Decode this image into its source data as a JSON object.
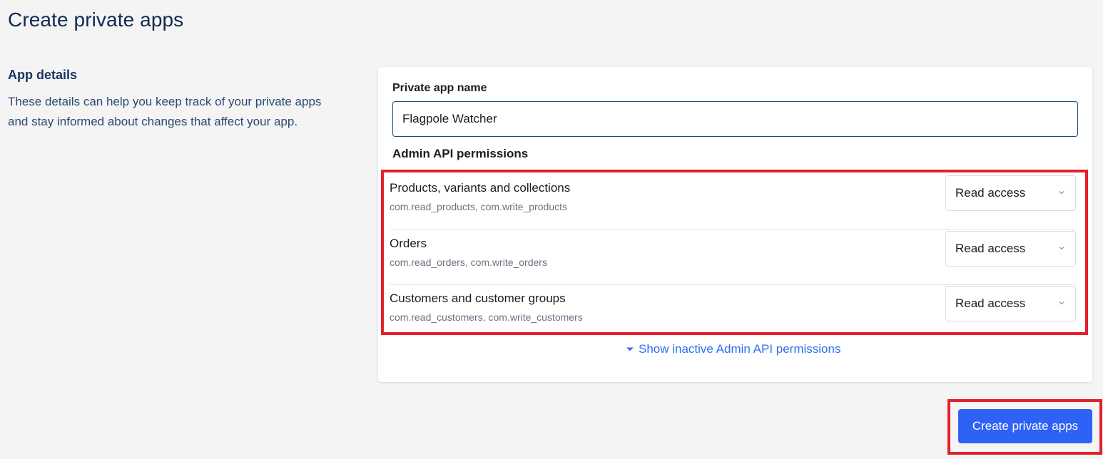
{
  "page": {
    "title": "Create private apps"
  },
  "app_details": {
    "heading": "App details",
    "description": "These details can help you keep track of your private apps and stay informed about changes that affect your app."
  },
  "form": {
    "name_label": "Private app name",
    "name_value": "Flagpole Watcher",
    "permissions_heading": "Admin API permissions",
    "permissions": [
      {
        "name": "Products, variants and collections",
        "scopes": "com.read_products, com.write_products",
        "access": "Read access"
      },
      {
        "name": "Orders",
        "scopes": "com.read_orders, com.write_orders",
        "access": "Read access"
      },
      {
        "name": "Customers and customer groups",
        "scopes": "com.read_customers, com.write_customers",
        "access": "Read access"
      }
    ],
    "show_inactive_label": "Show inactive Admin API permissions"
  },
  "actions": {
    "create_label": "Create private apps"
  },
  "colors": {
    "primary": "#2e61f5",
    "link": "#2f6ff5",
    "heading": "#0e2a53",
    "highlight": "#e3202b"
  },
  "icons": {
    "select_chevron": "chevron-down-icon",
    "show_inactive": "caret-down-icon"
  }
}
